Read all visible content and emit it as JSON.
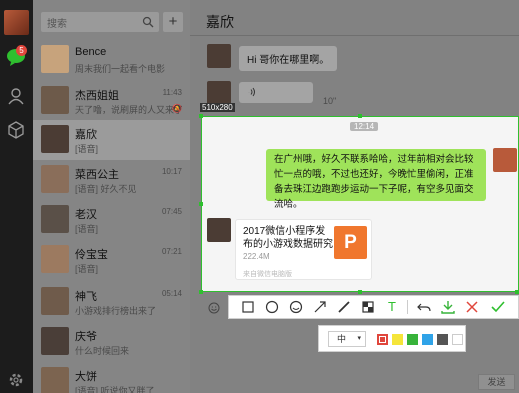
{
  "sidebar": {
    "unread_badge": "5"
  },
  "search": {
    "placeholder": "搜索",
    "add_label": "+"
  },
  "conversations": [
    {
      "name": "Bence",
      "message": "周末我们一起看个电影",
      "time": "",
      "color": "#c7a37c"
    },
    {
      "name": "杰西姐姐",
      "message": "天了噜，说刷屏的人又来了",
      "time": "11:43",
      "color": "#6d5a4a"
    },
    {
      "name": "嘉欣",
      "message": "[语音]",
      "time": "",
      "color": "#4b3c34"
    },
    {
      "name": "菜西公主",
      "message": "[语音] 好久不见",
      "time": "10:17",
      "color": "#8a6e5a"
    },
    {
      "name": "老汉",
      "message": "[语音]",
      "time": "07:45",
      "color": "#5a5048"
    },
    {
      "name": "伶宝宝",
      "message": "[语音]",
      "time": "07:21",
      "color": "#9c7a60"
    },
    {
      "name": "神飞",
      "message": "小游戏排行榜出来了",
      "time": "05:14",
      "color": "#6f5b4b"
    },
    {
      "name": "庆爷",
      "message": "什么时候回来",
      "time": "",
      "color": "#4a3e38"
    },
    {
      "name": "大饼",
      "message": "[语音] 听说你又胖了",
      "time": "",
      "color": "#7c6450"
    }
  ],
  "chat": {
    "title": "嘉欣",
    "msg1": "Hi 哥你在哪里啊。",
    "voice_length": "10\"",
    "voice_icon": "voice-wave-icon"
  },
  "capture": {
    "size": "510x280",
    "time": "12:14",
    "green_message": "在广州哦，好久不联系哈哈，过年前相对会比较忙一点的哦，不过也还好，今晚忙里偷闲，正准备去珠江边跑跑步运动一下子呢，有空多见面交流哈。",
    "card_title": "2017微信小程序发布的小游戏数据研究",
    "card_size": "222.4M",
    "card_footer": "来自微信电脑版",
    "card_icon_letter": "P"
  },
  "toolbar": {
    "tools": [
      "rect-icon",
      "ellipse-icon",
      "mosaic-icon",
      "arrow-icon",
      "pen-icon",
      "blur-icon",
      "text-icon",
      "undo-icon",
      "save-icon",
      "cancel-icon",
      "confirm-icon"
    ],
    "text_glyph": "T"
  },
  "subbar": {
    "font_size": "中",
    "colors": [
      "#e0463c",
      "#f5e53a",
      "#37b33a",
      "#2fa3e8",
      "#555555",
      "#ffffff"
    ]
  },
  "send_label": "发送"
}
